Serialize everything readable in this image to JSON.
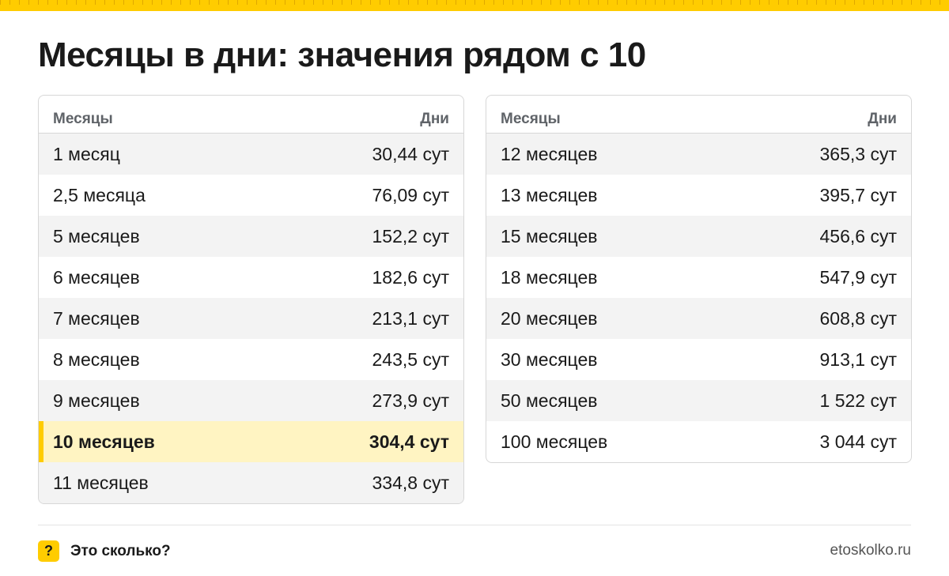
{
  "title": "Месяцы в дни: значения рядом с 10",
  "colors": {
    "accent": "#ffcc00",
    "highlight_row": "#fff4c2",
    "stripe": "#f3f3f3"
  },
  "table_left": {
    "header": {
      "col1": "Месяцы",
      "col2": "Дни"
    },
    "rows": [
      {
        "months": "1 месяц",
        "days": "30,44 сут"
      },
      {
        "months": "2,5 месяца",
        "days": "76,09 сут"
      },
      {
        "months": "5 месяцев",
        "days": "152,2 сут"
      },
      {
        "months": "6 месяцев",
        "days": "182,6 сут"
      },
      {
        "months": "7 месяцев",
        "days": "213,1 сут"
      },
      {
        "months": "8 месяцев",
        "days": "243,5 сут"
      },
      {
        "months": "9 месяцев",
        "days": "273,9 сут"
      },
      {
        "months": "10 месяцев",
        "days": "304,4 сут",
        "highlighted": true
      },
      {
        "months": "11 месяцев",
        "days": "334,8 сут"
      }
    ]
  },
  "table_right": {
    "header": {
      "col1": "Месяцы",
      "col2": "Дни"
    },
    "rows": [
      {
        "months": "12 месяцев",
        "days": "365,3 сут"
      },
      {
        "months": "13 месяцев",
        "days": "395,7 сут"
      },
      {
        "months": "15 месяцев",
        "days": "456,6 сут"
      },
      {
        "months": "18 месяцев",
        "days": "547,9 сут"
      },
      {
        "months": "20 месяцев",
        "days": "608,8 сут"
      },
      {
        "months": "30 месяцев",
        "days": "913,1 сут"
      },
      {
        "months": "50 месяцев",
        "days": "1 522 сут"
      },
      {
        "months": "100 месяцев",
        "days": "3 044 сут"
      }
    ]
  },
  "footer": {
    "icon_symbol": "?",
    "brand": "Это сколько?",
    "site": "etoskolko.ru"
  }
}
